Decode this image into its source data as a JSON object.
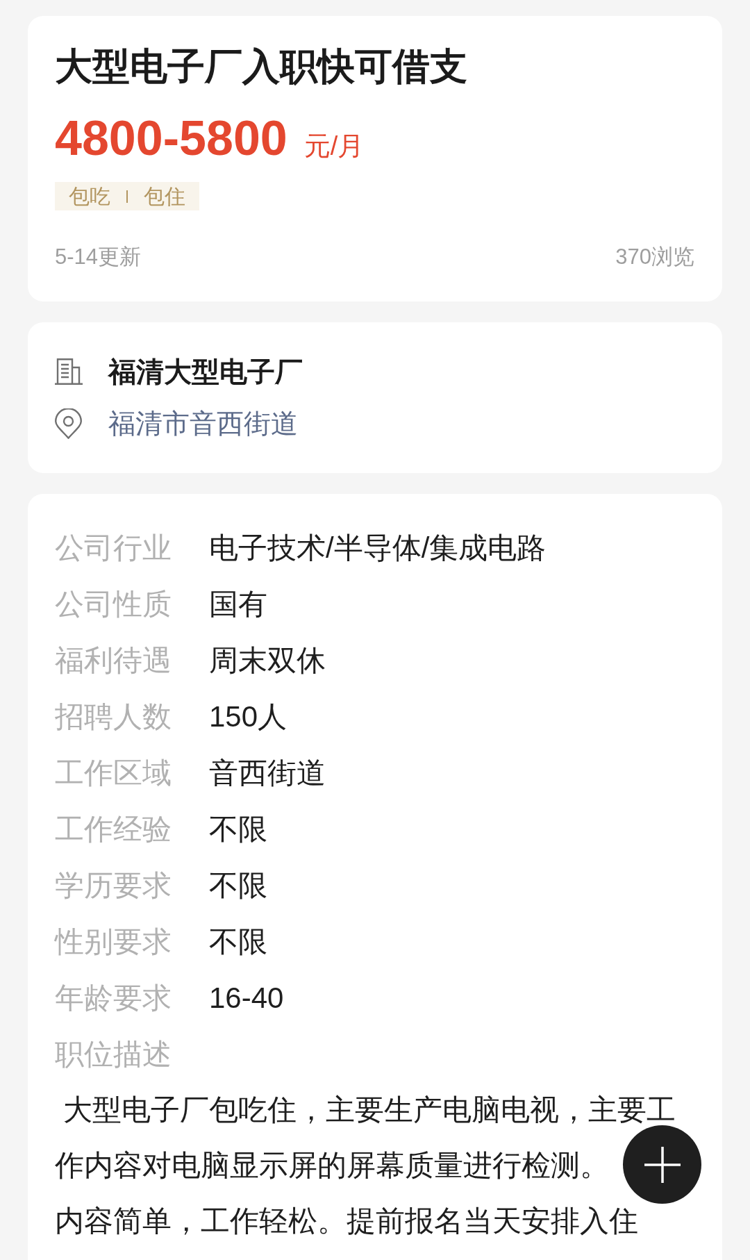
{
  "job": {
    "title": "大型电子厂入职快可借支",
    "salary": "4800-5800",
    "salary_unit": "元/月",
    "benefits": [
      "包吃",
      "包住"
    ],
    "updated": "5-14更新",
    "views": "370浏览"
  },
  "company": {
    "name": "福清大型电子厂",
    "address": "福清市音西街道"
  },
  "details": {
    "rows": [
      {
        "label": "公司行业",
        "value": "电子技术/半导体/集成电路"
      },
      {
        "label": "公司性质",
        "value": "国有"
      },
      {
        "label": "福利待遇",
        "value": "周末双休"
      },
      {
        "label": "招聘人数",
        "value": "150人"
      },
      {
        "label": "工作区域",
        "value": "音西街道"
      },
      {
        "label": "工作经验",
        "value": "不限"
      },
      {
        "label": "学历要求",
        "value": "不限"
      },
      {
        "label": "性别要求",
        "value": "不限"
      },
      {
        "label": "年龄要求",
        "value": "16-40"
      },
      {
        "label": "职位描述"
      }
    ],
    "description_lines": [
      " 大型电子厂包吃住，主要生产电脑电视，主要工",
      "作内容对电脑显示屏的屏幕质量进行检测。",
      "内容简单，工作轻松。提前报名当天安排入住"
    ]
  }
}
